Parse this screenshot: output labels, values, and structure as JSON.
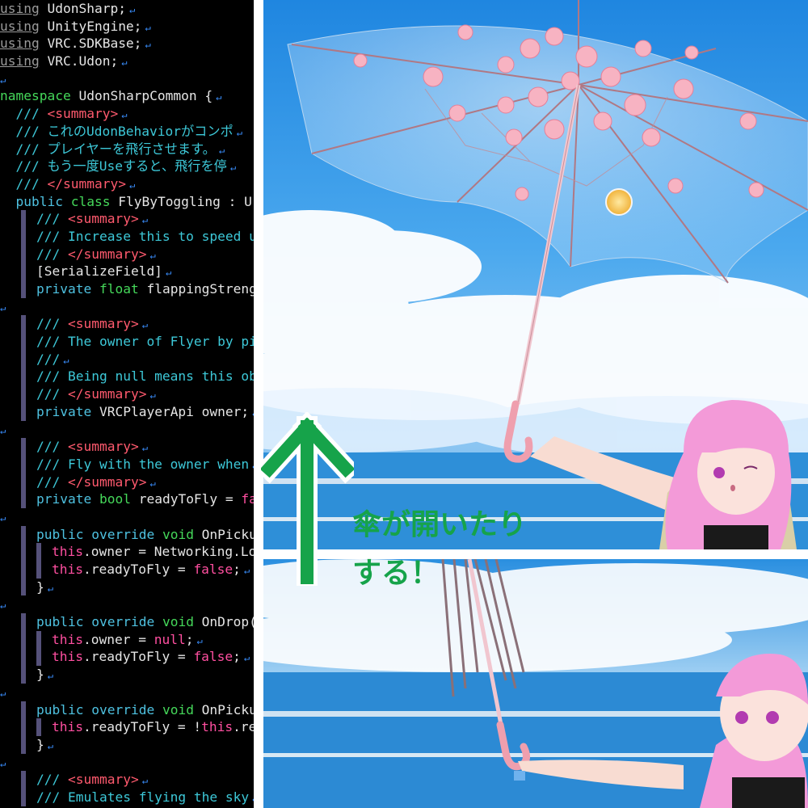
{
  "editor": {
    "lines": [
      [
        [
          "us",
          "using"
        ],
        [
          "id",
          " UdonSharp;"
        ]
      ],
      [
        [
          "us",
          "using"
        ],
        [
          "id",
          " UnityEngine;"
        ]
      ],
      [
        [
          "us",
          "using"
        ],
        [
          "id",
          " VRC.SDKBase;"
        ]
      ],
      [
        [
          "us",
          "using"
        ],
        [
          "id",
          " VRC.Udon;"
        ]
      ],
      [],
      [
        [
          "ns",
          "namespace"
        ],
        [
          "id",
          " UdonSharpCommon {"
        ]
      ],
      [
        [
          "id",
          "  "
        ],
        [
          "cm",
          "/// "
        ],
        [
          "tag",
          "<summary>"
        ]
      ],
      [
        [
          "id",
          "  "
        ],
        [
          "cm",
          "/// これのUdonBehaviorがコンポ"
        ]
      ],
      [
        [
          "id",
          "  "
        ],
        [
          "cm",
          "/// プレイヤーを飛行させます。"
        ]
      ],
      [
        [
          "id",
          "  "
        ],
        [
          "cm",
          "/// もう一度Useすると、飛行を停"
        ]
      ],
      [
        [
          "id",
          "  "
        ],
        [
          "cm",
          "/// "
        ],
        [
          "tag",
          "</summary>"
        ]
      ],
      [
        [
          "id",
          "  "
        ],
        [
          "kw",
          "public"
        ],
        [
          "id",
          " "
        ],
        [
          "ty",
          "class"
        ],
        [
          "id",
          " FlyByToggling : U"
        ]
      ],
      [
        [
          "IND",
          ""
        ],
        [
          "cm",
          "/// "
        ],
        [
          "tag",
          "<summary>"
        ]
      ],
      [
        [
          "IND",
          ""
        ],
        [
          "cm",
          "/// Increase this to speed u"
        ]
      ],
      [
        [
          "IND",
          ""
        ],
        [
          "cm",
          "/// "
        ],
        [
          "tag",
          "</summary>"
        ]
      ],
      [
        [
          "IND",
          ""
        ],
        [
          "id",
          "[SerializeField]"
        ]
      ],
      [
        [
          "IND",
          ""
        ],
        [
          "kw",
          "private"
        ],
        [
          "id",
          " "
        ],
        [
          "ty",
          "float"
        ],
        [
          "id",
          " flappingStreng"
        ]
      ],
      [],
      [
        [
          "IND",
          ""
        ],
        [
          "cm",
          "/// "
        ],
        [
          "tag",
          "<summary>"
        ]
      ],
      [
        [
          "IND",
          ""
        ],
        [
          "cm",
          "/// The owner of Flyer by pi"
        ]
      ],
      [
        [
          "IND",
          ""
        ],
        [
          "cm",
          "///"
        ]
      ],
      [
        [
          "IND",
          ""
        ],
        [
          "cm",
          "/// Being null means this ob"
        ]
      ],
      [
        [
          "IND",
          ""
        ],
        [
          "cm",
          "/// "
        ],
        [
          "tag",
          "</summary>"
        ]
      ],
      [
        [
          "IND",
          ""
        ],
        [
          "kw",
          "private"
        ],
        [
          "id",
          " VRCPlayerApi owner;"
        ]
      ],
      [],
      [
        [
          "IND",
          ""
        ],
        [
          "cm",
          "/// "
        ],
        [
          "tag",
          "<summary>"
        ]
      ],
      [
        [
          "IND",
          ""
        ],
        [
          "cm",
          "/// Fly with the owner when"
        ]
      ],
      [
        [
          "IND",
          ""
        ],
        [
          "cm",
          "/// "
        ],
        [
          "tag",
          "</summary>"
        ]
      ],
      [
        [
          "IND",
          ""
        ],
        [
          "kw",
          "private"
        ],
        [
          "id",
          " "
        ],
        [
          "ty",
          "bool"
        ],
        [
          "id",
          " readyToFly = "
        ],
        [
          "nu",
          "fa"
        ]
      ],
      [],
      [
        [
          "IND",
          ""
        ],
        [
          "kw",
          "public"
        ],
        [
          "id",
          " "
        ],
        [
          "kw",
          "override"
        ],
        [
          "id",
          " "
        ],
        [
          "ty",
          "void"
        ],
        [
          "id",
          " OnPicku"
        ]
      ],
      [
        [
          "IND",
          ""
        ],
        [
          "IND",
          ""
        ],
        [
          "th",
          "this"
        ],
        [
          "id",
          ".owner = Networking.Lo"
        ]
      ],
      [
        [
          "IND",
          ""
        ],
        [
          "IND",
          ""
        ],
        [
          "th",
          "this"
        ],
        [
          "id",
          ".readyToFly = "
        ],
        [
          "nu",
          "false"
        ],
        [
          "id",
          ";"
        ]
      ],
      [
        [
          "IND",
          ""
        ],
        [
          "id",
          "}"
        ]
      ],
      [],
      [
        [
          "IND",
          ""
        ],
        [
          "kw",
          "public"
        ],
        [
          "id",
          " "
        ],
        [
          "kw",
          "override"
        ],
        [
          "id",
          " "
        ],
        [
          "ty",
          "void"
        ],
        [
          "id",
          " OnDrop("
        ]
      ],
      [
        [
          "IND",
          ""
        ],
        [
          "IND",
          ""
        ],
        [
          "th",
          "this"
        ],
        [
          "id",
          ".owner = "
        ],
        [
          "nu",
          "null"
        ],
        [
          "id",
          ";"
        ]
      ],
      [
        [
          "IND",
          ""
        ],
        [
          "IND",
          ""
        ],
        [
          "th",
          "this"
        ],
        [
          "id",
          ".readyToFly = "
        ],
        [
          "nu",
          "false"
        ],
        [
          "id",
          ";"
        ]
      ],
      [
        [
          "IND",
          ""
        ],
        [
          "id",
          "}"
        ]
      ],
      [],
      [
        [
          "IND",
          ""
        ],
        [
          "kw",
          "public"
        ],
        [
          "id",
          " "
        ],
        [
          "kw",
          "override"
        ],
        [
          "id",
          " "
        ],
        [
          "ty",
          "void"
        ],
        [
          "id",
          " OnPicku"
        ]
      ],
      [
        [
          "IND",
          ""
        ],
        [
          "IND",
          ""
        ],
        [
          "th",
          "this"
        ],
        [
          "id",
          ".readyToFly = !"
        ],
        [
          "th",
          "this"
        ],
        [
          "id",
          ".re"
        ]
      ],
      [
        [
          "IND",
          ""
        ],
        [
          "id",
          "}"
        ]
      ],
      [],
      [
        [
          "IND",
          ""
        ],
        [
          "cm",
          "/// "
        ],
        [
          "tag",
          "<summary>"
        ]
      ],
      [
        [
          "IND",
          ""
        ],
        [
          "cm",
          "/// Emulates flying the sky"
        ]
      ]
    ],
    "eol_marker": "↵"
  },
  "annotation": {
    "caption_line1": "傘が開いたり",
    "caption_line2": "する！"
  },
  "colors": {
    "accent_green": "#16a34a",
    "sky": "#3f9ee6",
    "umbrella_pink": "#f4a6b6"
  }
}
